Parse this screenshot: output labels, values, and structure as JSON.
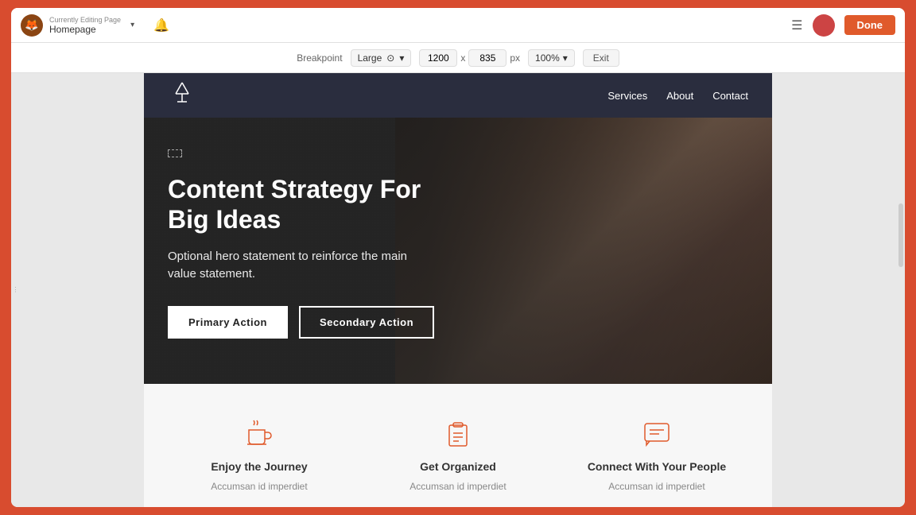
{
  "editor": {
    "background_color": "#d84c2f",
    "editing_label": "Currently Editing Page",
    "page_name": "Homepage",
    "done_button": "Done",
    "bell_icon": "🔔",
    "settings_icon": "≡"
  },
  "breakpoint_bar": {
    "label": "Breakpoint",
    "selected": "Large",
    "width_value": "1200",
    "height_value": "835",
    "px_label": "px",
    "zoom": "100%",
    "exit_label": "Exit"
  },
  "site": {
    "nav": {
      "logo_alt": "Lamp logo",
      "links": [
        {
          "label": "Services"
        },
        {
          "label": "About"
        },
        {
          "label": "Contact"
        }
      ]
    },
    "hero": {
      "title": "Content Strategy For Big Ideas",
      "subtitle": "Optional hero statement to reinforce the main value statement.",
      "primary_action": "Primary Action",
      "secondary_action": "Secondary Action"
    },
    "features": [
      {
        "icon": "coffee",
        "title": "Enjoy the Journey",
        "desc": "Accumsan id imperdiet"
      },
      {
        "icon": "clipboard",
        "title": "Get Organized",
        "desc": "Accumsan id imperdiet"
      },
      {
        "icon": "chat",
        "title": "Connect With Your People",
        "desc": "Accumsan id imperdiet"
      }
    ]
  }
}
